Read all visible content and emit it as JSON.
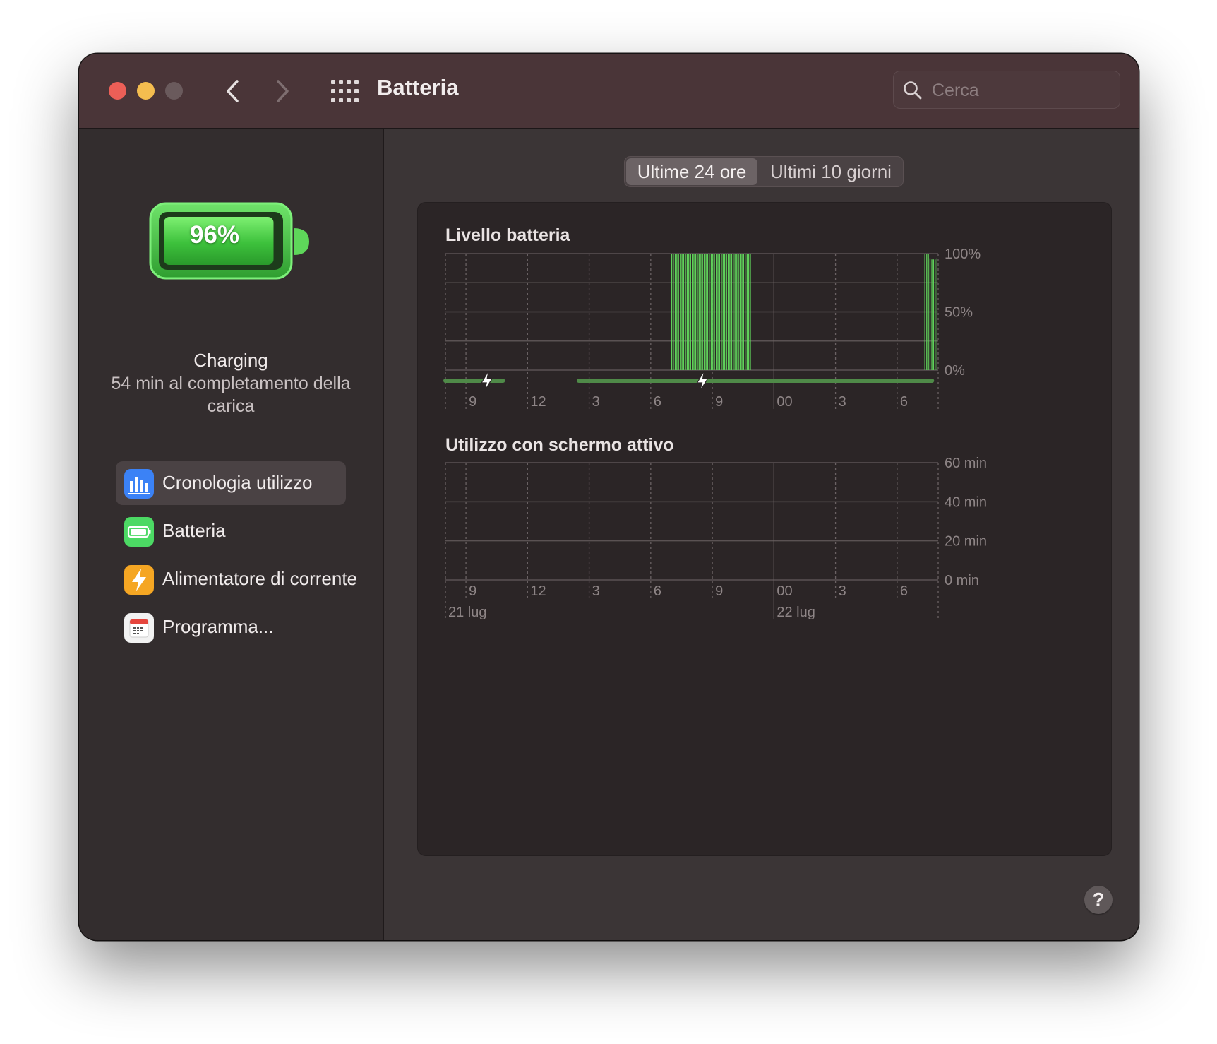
{
  "window": {
    "title": "Batteria",
    "search_placeholder": "Cerca"
  },
  "status": {
    "battery_percent": "96%",
    "battery_level": 0.96,
    "title": "Charging",
    "subtitle": "54 min al completamento della carica"
  },
  "sidebar": {
    "items": [
      {
        "label": "Cronologia utilizzo",
        "icon": "bar-chart-icon",
        "color": "#3b82f6",
        "selected": true
      },
      {
        "label": "Batteria",
        "icon": "battery-icon",
        "color": "#4cd964",
        "selected": false
      },
      {
        "label": "Alimentatore di corrente",
        "icon": "lightning-icon",
        "color": "#f5a623",
        "selected": false
      },
      {
        "label": "Programma...",
        "icon": "calendar-icon",
        "color": "#f2f2f2",
        "selected": false
      }
    ]
  },
  "tabs": [
    {
      "label": "Ultime 24 ore",
      "selected": true
    },
    {
      "label": "Ultimi 10 giorni",
      "selected": false
    }
  ],
  "chart_data": [
    {
      "type": "bar",
      "title": "Livello batteria",
      "x_ticks": [
        "9",
        "12",
        "3",
        "6",
        "9",
        "00",
        "3",
        "6"
      ],
      "y_ticks": [
        "100%",
        "50%",
        "0%"
      ],
      "ylim": [
        0,
        100
      ],
      "color": "#5fd15a",
      "charging_color": "#4f8a48",
      "bars": [
        {
          "hour": 19.0,
          "value": 100
        },
        {
          "hour": 19.08,
          "value": 100
        },
        {
          "hour": 19.17,
          "value": 100
        },
        {
          "hour": 19.25,
          "value": 100
        },
        {
          "hour": 19.33,
          "value": 100
        },
        {
          "hour": 19.42,
          "value": 100
        },
        {
          "hour": 19.5,
          "value": 100
        },
        {
          "hour": 19.58,
          "value": 100
        },
        {
          "hour": 19.67,
          "value": 100
        },
        {
          "hour": 19.75,
          "value": 100
        },
        {
          "hour": 19.83,
          "value": 100
        },
        {
          "hour": 19.92,
          "value": 100
        },
        {
          "hour": 20.0,
          "value": 100
        },
        {
          "hour": 20.08,
          "value": 100
        },
        {
          "hour": 20.17,
          "value": 100
        },
        {
          "hour": 20.25,
          "value": 100
        },
        {
          "hour": 20.33,
          "value": 100
        },
        {
          "hour": 20.42,
          "value": 100
        },
        {
          "hour": 20.5,
          "value": 100
        },
        {
          "hour": 20.58,
          "value": 100
        },
        {
          "hour": 20.67,
          "value": 100
        },
        {
          "hour": 20.75,
          "value": 100
        },
        {
          "hour": 20.83,
          "value": 100
        },
        {
          "hour": 20.92,
          "value": 100
        },
        {
          "hour": 21.0,
          "value": 100
        },
        {
          "hour": 21.08,
          "value": 100
        },
        {
          "hour": 21.17,
          "value": 100
        },
        {
          "hour": 21.25,
          "value": 100
        },
        {
          "hour": 21.33,
          "value": 100
        },
        {
          "hour": 21.42,
          "value": 100
        },
        {
          "hour": 21.5,
          "value": 100
        },
        {
          "hour": 21.58,
          "value": 100
        },
        {
          "hour": 21.67,
          "value": 100
        },
        {
          "hour": 21.75,
          "value": 100
        },
        {
          "hour": 21.83,
          "value": 100
        },
        {
          "hour": 21.92,
          "value": 100
        },
        {
          "hour": 22.0,
          "value": 100
        },
        {
          "hour": 22.08,
          "value": 100
        },
        {
          "hour": 22.17,
          "value": 100
        },
        {
          "hour": 22.25,
          "value": 100
        },
        {
          "hour": 22.33,
          "value": 100
        },
        {
          "hour": 22.42,
          "value": 100
        },
        {
          "hour": 22.5,
          "value": 100
        },
        {
          "hour": 22.58,
          "value": 100
        },
        {
          "hour": 22.67,
          "value": 100
        },
        {
          "hour": 22.75,
          "value": 100
        },
        {
          "hour": 22.83,
          "value": 100
        },
        {
          "hour": 31.33,
          "value": 100
        },
        {
          "hour": 31.42,
          "value": 100
        },
        {
          "hour": 31.5,
          "value": 100
        },
        {
          "hour": 31.58,
          "value": 96
        },
        {
          "hour": 31.67,
          "value": 95
        },
        {
          "hour": 31.75,
          "value": 95
        },
        {
          "hour": 31.83,
          "value": 95
        },
        {
          "hour": 31.92,
          "value": 96
        }
      ],
      "charging_segments": [
        {
          "start": 8.0,
          "end": 10.8
        },
        {
          "start": 14.5,
          "end": 31.7
        }
      ],
      "charging_markers": [
        10.0,
        20.5
      ]
    },
    {
      "type": "bar",
      "title": "Utilizzo con schermo attivo",
      "x_ticks": [
        "9",
        "12",
        "3",
        "6",
        "9",
        "00",
        "3",
        "6"
      ],
      "date_labels": [
        "21 lug",
        "22 lug"
      ],
      "y_ticks": [
        "60 min",
        "40 min",
        "20 min",
        "0 min"
      ],
      "ylim": [
        0,
        60
      ],
      "bars": []
    }
  ],
  "help_label": "?"
}
